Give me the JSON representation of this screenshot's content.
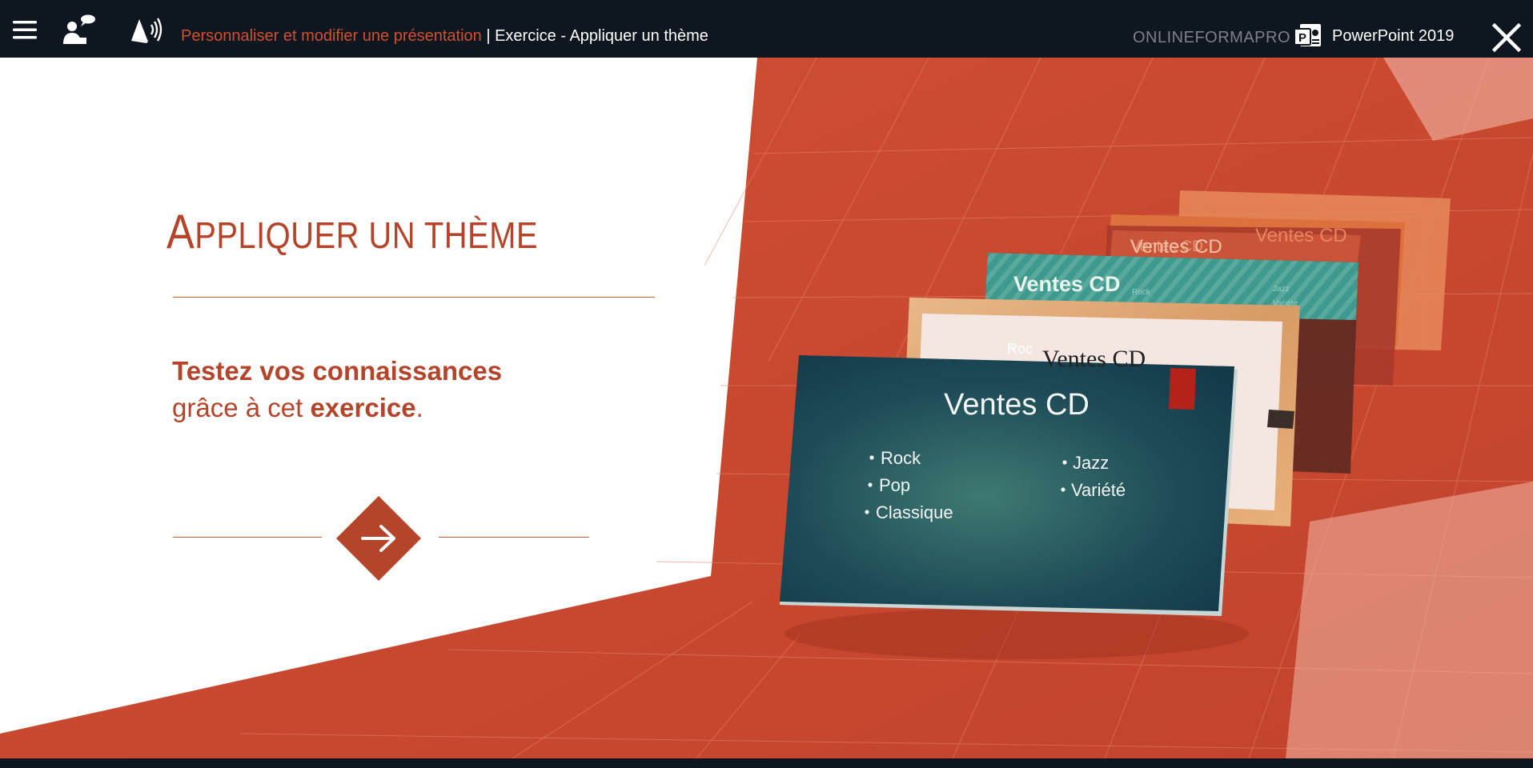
{
  "header": {
    "breadcrumb_parent": "Personnaliser et modifier une présentation",
    "breadcrumb_separator": " | ",
    "breadcrumb_current": "Exercice - Appliquer un thème",
    "brand": "ONLINEFORMAPRO",
    "product": "PowerPoint 2019",
    "icons": {
      "menu": "hamburger-menu-icon",
      "tutor": "tutor-speech-icon",
      "audio": "audio-speaker-icon",
      "product": "powerpoint-icon",
      "close": "close-icon"
    }
  },
  "lesson": {
    "title": "Appliquer un thème",
    "intro_line1": "Testez vos connaissances",
    "intro_line2_prefix": "grâce à cet ",
    "intro_line2_strong": "exercice",
    "intro_line2_suffix": ".",
    "next_icon": "arrow-right-icon"
  },
  "illustration": {
    "slide_title": "Ventes CD",
    "bullets_left": [
      "Rock",
      "Pop",
      "Classique"
    ],
    "bullets_right": [
      "Jazz",
      "Variété"
    ],
    "back_slide_bullet": "Roc",
    "tiny_left": [
      "Rock",
      "Pop"
    ],
    "tiny_right": [
      "Jazz",
      "Variété"
    ]
  },
  "colors": {
    "accent": "#b4442a",
    "topbar": "#0e1720",
    "stage_orange": "#cc4a30",
    "slide_teal": "#1f4f5a"
  }
}
